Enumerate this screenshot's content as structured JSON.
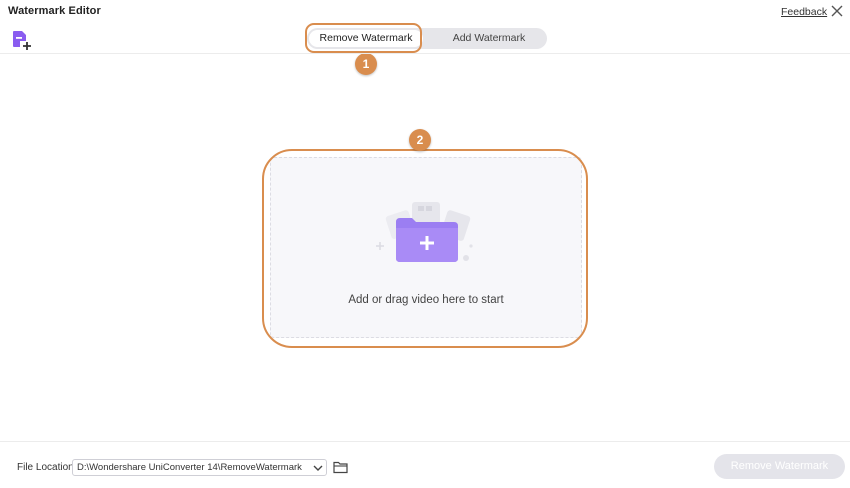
{
  "window": {
    "title": "Watermark Editor",
    "feedback_label": "Feedback",
    "close_icon": "close-icon"
  },
  "toolbar": {
    "add_file_icon": "add-file-icon"
  },
  "tabs": [
    {
      "label": "Remove Watermark",
      "active": true
    },
    {
      "label": "Add Watermark",
      "active": false
    }
  ],
  "annotations": {
    "step1": "1",
    "step2": "2",
    "highlight_color": "#d98d4e"
  },
  "dropzone": {
    "text": "Add or drag video here to start",
    "icon": "add-folder-icon",
    "accent_color": "#9b7ef2"
  },
  "footer": {
    "file_location_label": "File Location:",
    "file_location_value": "D:\\Wondershare UniConverter 14\\RemoveWatermark",
    "folder_icon": "folder-icon",
    "action_button_label": "Remove Watermark",
    "action_button_enabled": false
  }
}
